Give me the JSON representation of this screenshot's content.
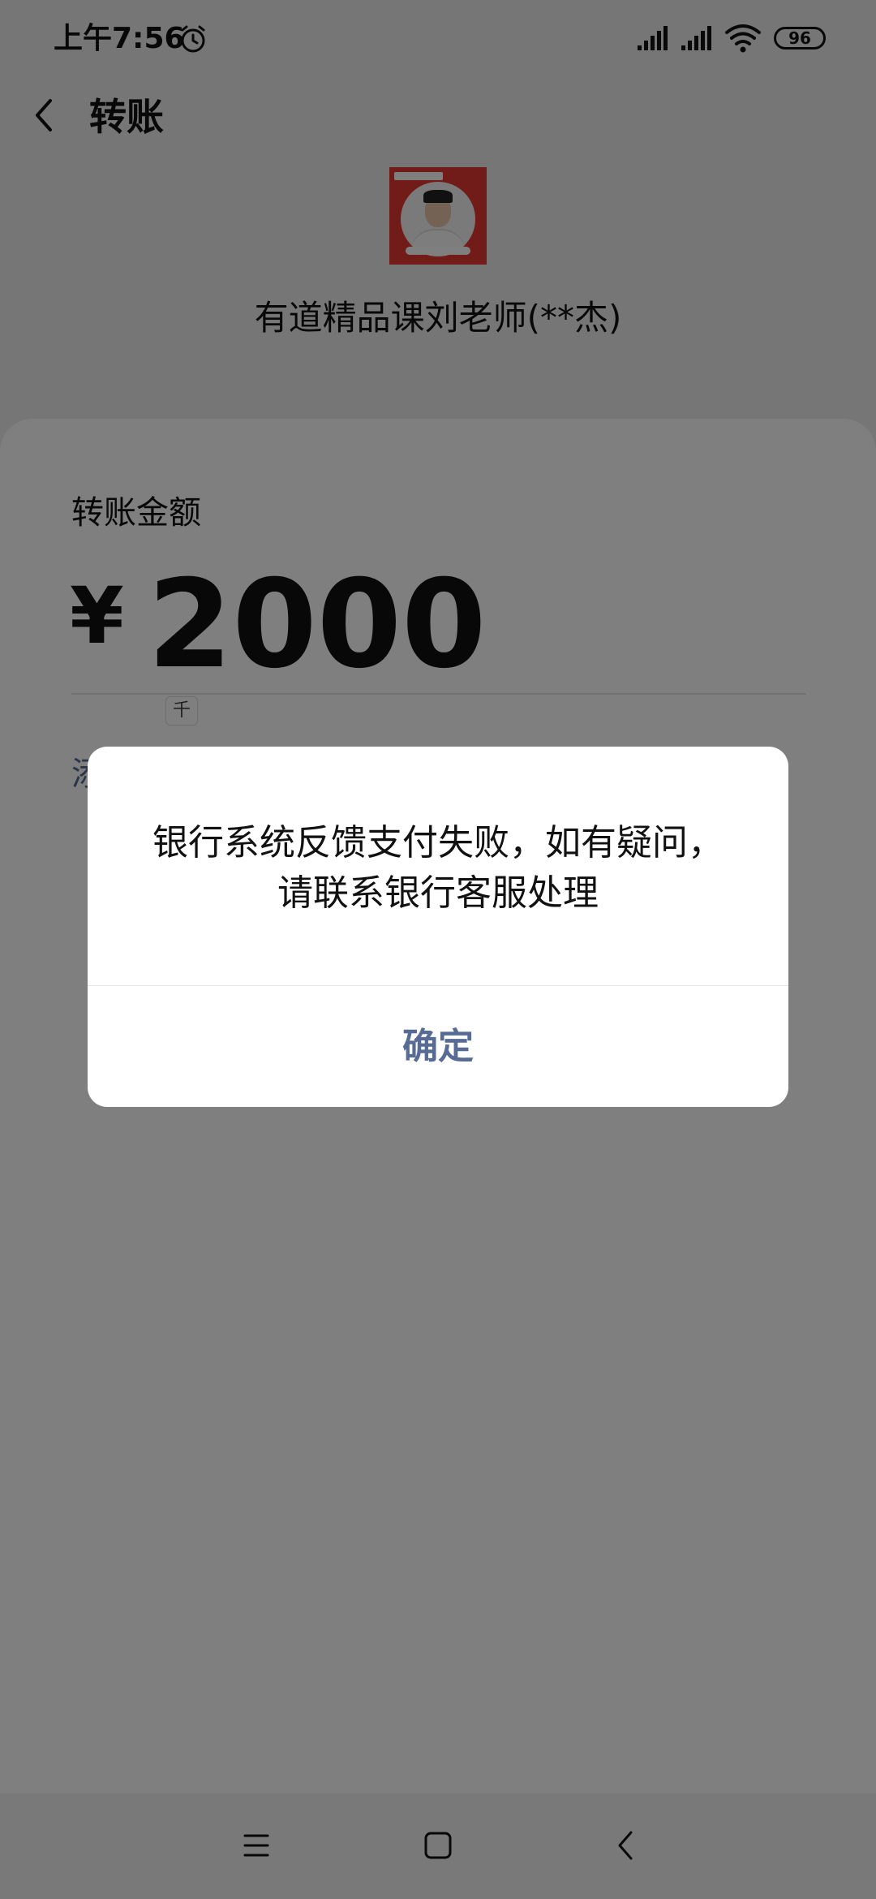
{
  "status_bar": {
    "time": "上午7:56",
    "battery": "96"
  },
  "header": {
    "title": "转账"
  },
  "payee": {
    "name": "有道精品课刘老师(**杰)"
  },
  "transfer": {
    "amount_label": "转账金额",
    "currency_symbol": "¥",
    "amount": "2000",
    "unit_hint": "千",
    "note_link_partial": "添"
  },
  "dialog": {
    "message_line1": "银行系统反馈支付失败，如有疑问，",
    "message_line2": "请联系银行客服处理",
    "confirm_label": "确定"
  },
  "colors": {
    "link": "#576b95",
    "overlay": "rgba(0,0,0,0.5)"
  },
  "icons": {
    "status": [
      "alarm-icon",
      "signal-icon",
      "signal-icon",
      "wifi-icon"
    ],
    "nav": [
      "menu-icon",
      "home-icon",
      "back-icon"
    ]
  }
}
